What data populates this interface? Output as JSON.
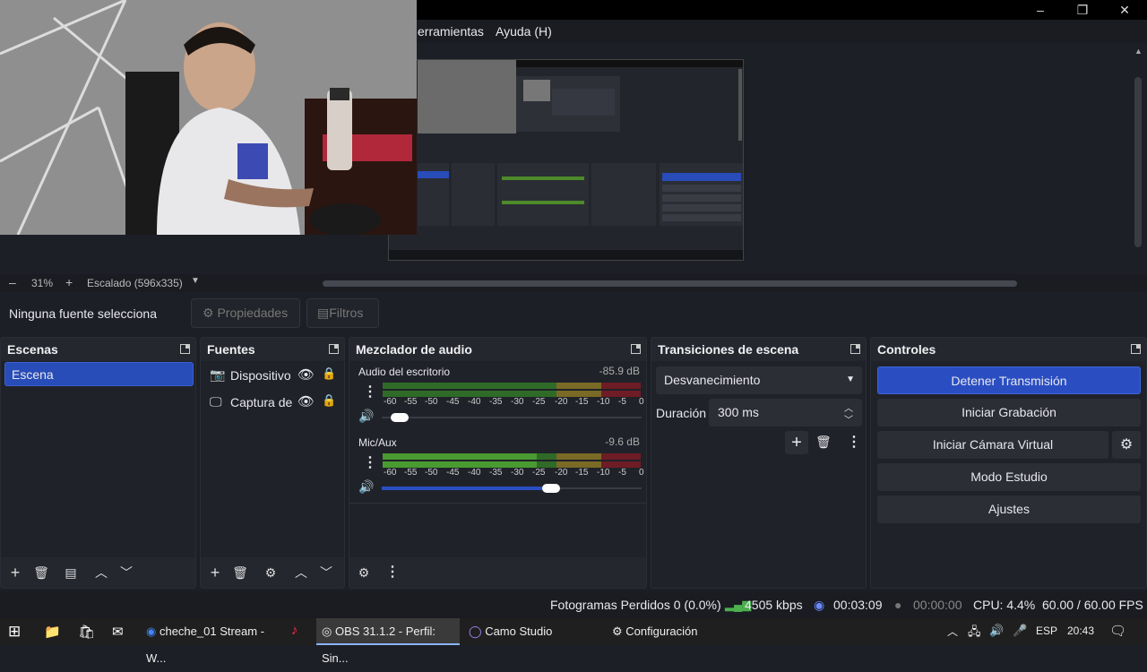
{
  "window": {
    "minimize": "–",
    "restore": "❐",
    "close": "✕"
  },
  "menu": {
    "tools": "erramientas",
    "help": "Ayuda (H)"
  },
  "zoom": {
    "minus": "–",
    "value": "31%",
    "plus": "+",
    "scaling": "Escalado (596x335)"
  },
  "source_toolbar": {
    "status": "Ninguna fuente selecciona",
    "properties": "Propiedades",
    "filters": "Filtros"
  },
  "scenes": {
    "title": "Escenas",
    "items": [
      {
        "label": "Escena",
        "selected": true
      }
    ]
  },
  "sources": {
    "title": "Fuentes",
    "items": [
      {
        "label": "Dispositivo",
        "icon": "camera-icon"
      },
      {
        "label": "Captura de",
        "icon": "monitor-icon"
      }
    ]
  },
  "mixer": {
    "title": "Mezclador de audio",
    "channels": [
      {
        "name": "Audio del escritorio",
        "db": "-85.9 dB",
        "level": 0.0,
        "volume": 0.07
      },
      {
        "name": "Mic/Aux",
        "db": "-9.6 dB",
        "level": 0.6,
        "volume": 0.65
      }
    ],
    "ticks": [
      "-60",
      "-55",
      "-50",
      "-45",
      "-40",
      "-35",
      "-30",
      "-25",
      "-20",
      "-15",
      "-10",
      "-5",
      "0"
    ]
  },
  "transitions": {
    "title": "Transiciones de escena",
    "selected": "Desvanecimiento",
    "duration_label": "Duración",
    "duration_value": "300 ms"
  },
  "controls": {
    "title": "Controles",
    "stop_stream": "Detener Transmisión",
    "start_recording": "Iniciar Grabación",
    "start_virtual_cam": "Iniciar Cámara Virtual",
    "studio_mode": "Modo Estudio",
    "settings": "Ajustes",
    "accent": "#2a4ec2"
  },
  "status": {
    "dropped": "Fotogramas Perdidos 0 (0.0%)",
    "bitrate": "4505 kbps",
    "stream_time": "00:03:09",
    "rec_time": "00:00:00",
    "cpu": "CPU: 4.4%",
    "fps": "60.00 / 60.00 FPS"
  },
  "taskbar": {
    "tasks": [
      {
        "label": "cheche_01 Stream - W..."
      },
      {
        "label": "OBS 31.1.2 - Perfil: Sin..."
      },
      {
        "label": "Camo Studio"
      },
      {
        "label": "Configuración"
      }
    ],
    "lang": "ESP",
    "time": "20:43"
  }
}
